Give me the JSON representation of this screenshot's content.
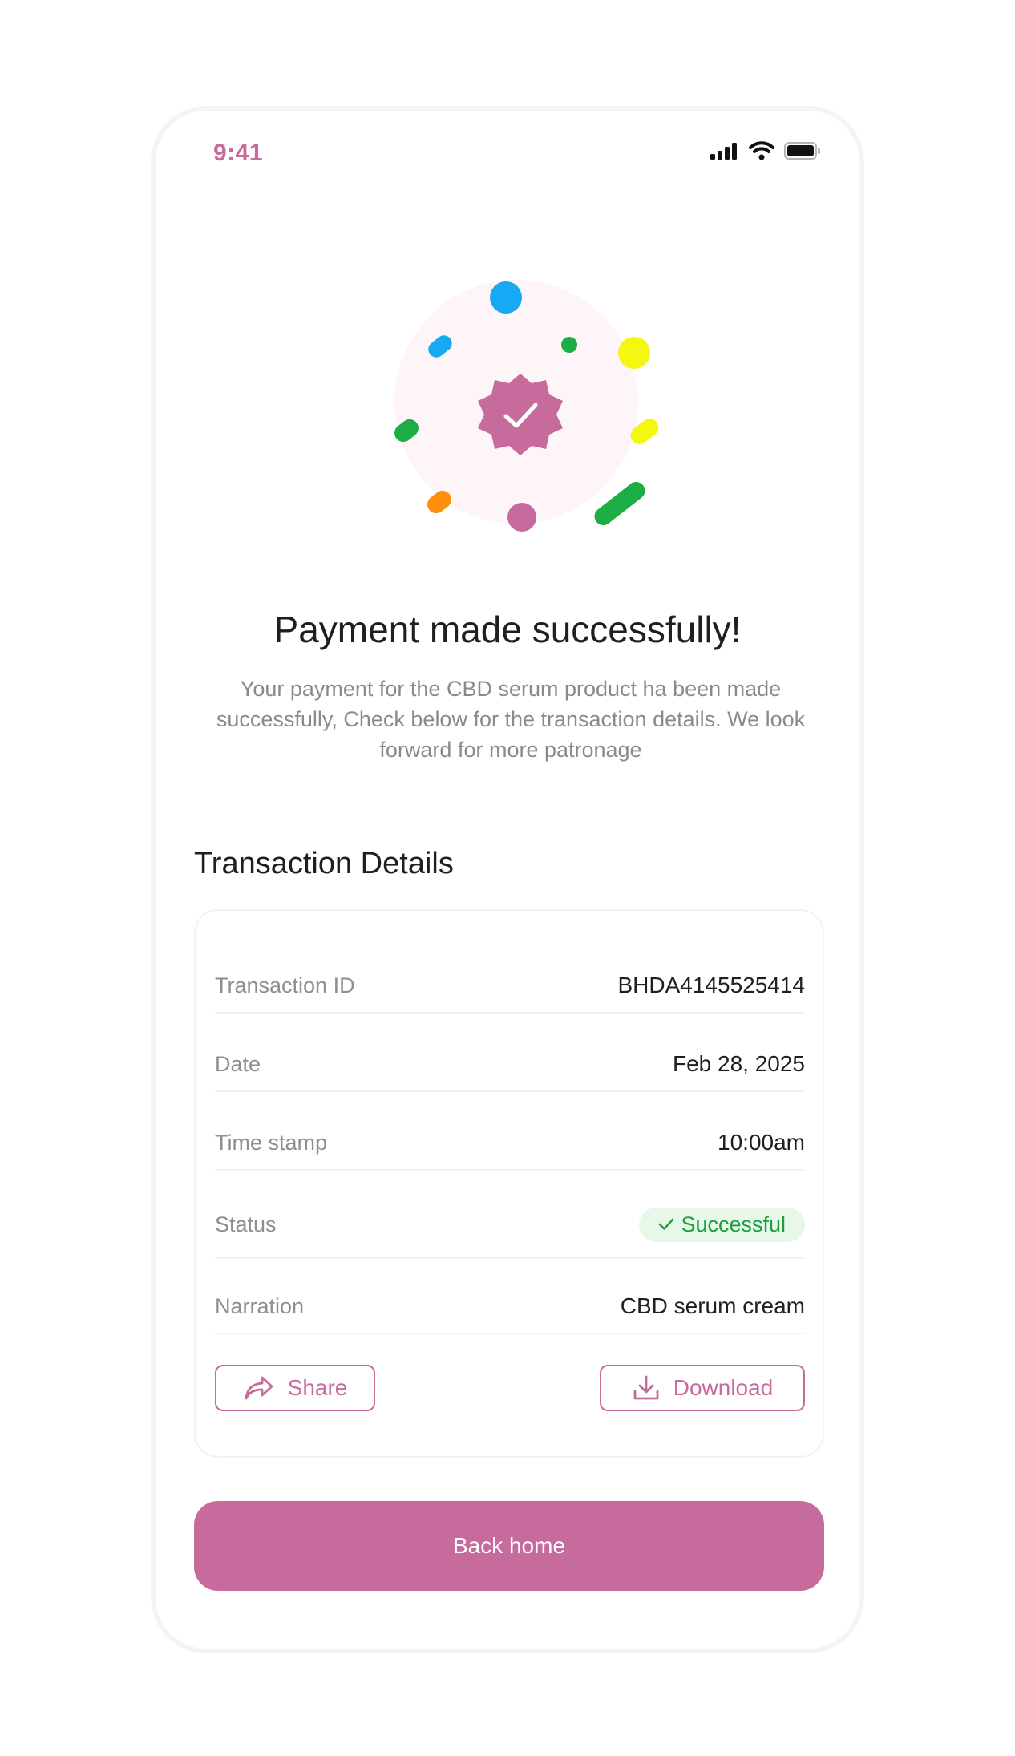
{
  "status_bar": {
    "time": "9:41",
    "icons": [
      "signal-icon",
      "wifi-icon",
      "battery-icon"
    ]
  },
  "hero": {
    "icon": "verified-check-badge-icon",
    "title": "Payment made successfully!",
    "message": "Your payment for the CBD serum product ha been made successfully, Check below for the transaction details. We look forward for more patronage"
  },
  "transaction": {
    "section_title": "Transaction Details",
    "rows": [
      {
        "label": "Transaction ID",
        "value": "BHDA4145525414"
      },
      {
        "label": "Date",
        "value": "Feb 28, 2025"
      },
      {
        "label": "Time stamp",
        "value": "10:00am"
      },
      {
        "label": "Status",
        "value": "Successful"
      },
      {
        "label": "Narration",
        "value": "CBD serum cream"
      }
    ],
    "share_label": "Share",
    "download_label": "Download"
  },
  "actions": {
    "back_home_label": "Back home"
  },
  "colors": {
    "accent": "#c76b9c",
    "success": "#1f9d3f",
    "success_bg": "#e7f7ea",
    "confetti": [
      "#18a9f5",
      "#f4f70e",
      "#1cad45",
      "#ff8f0a",
      "#c76b9c"
    ]
  }
}
